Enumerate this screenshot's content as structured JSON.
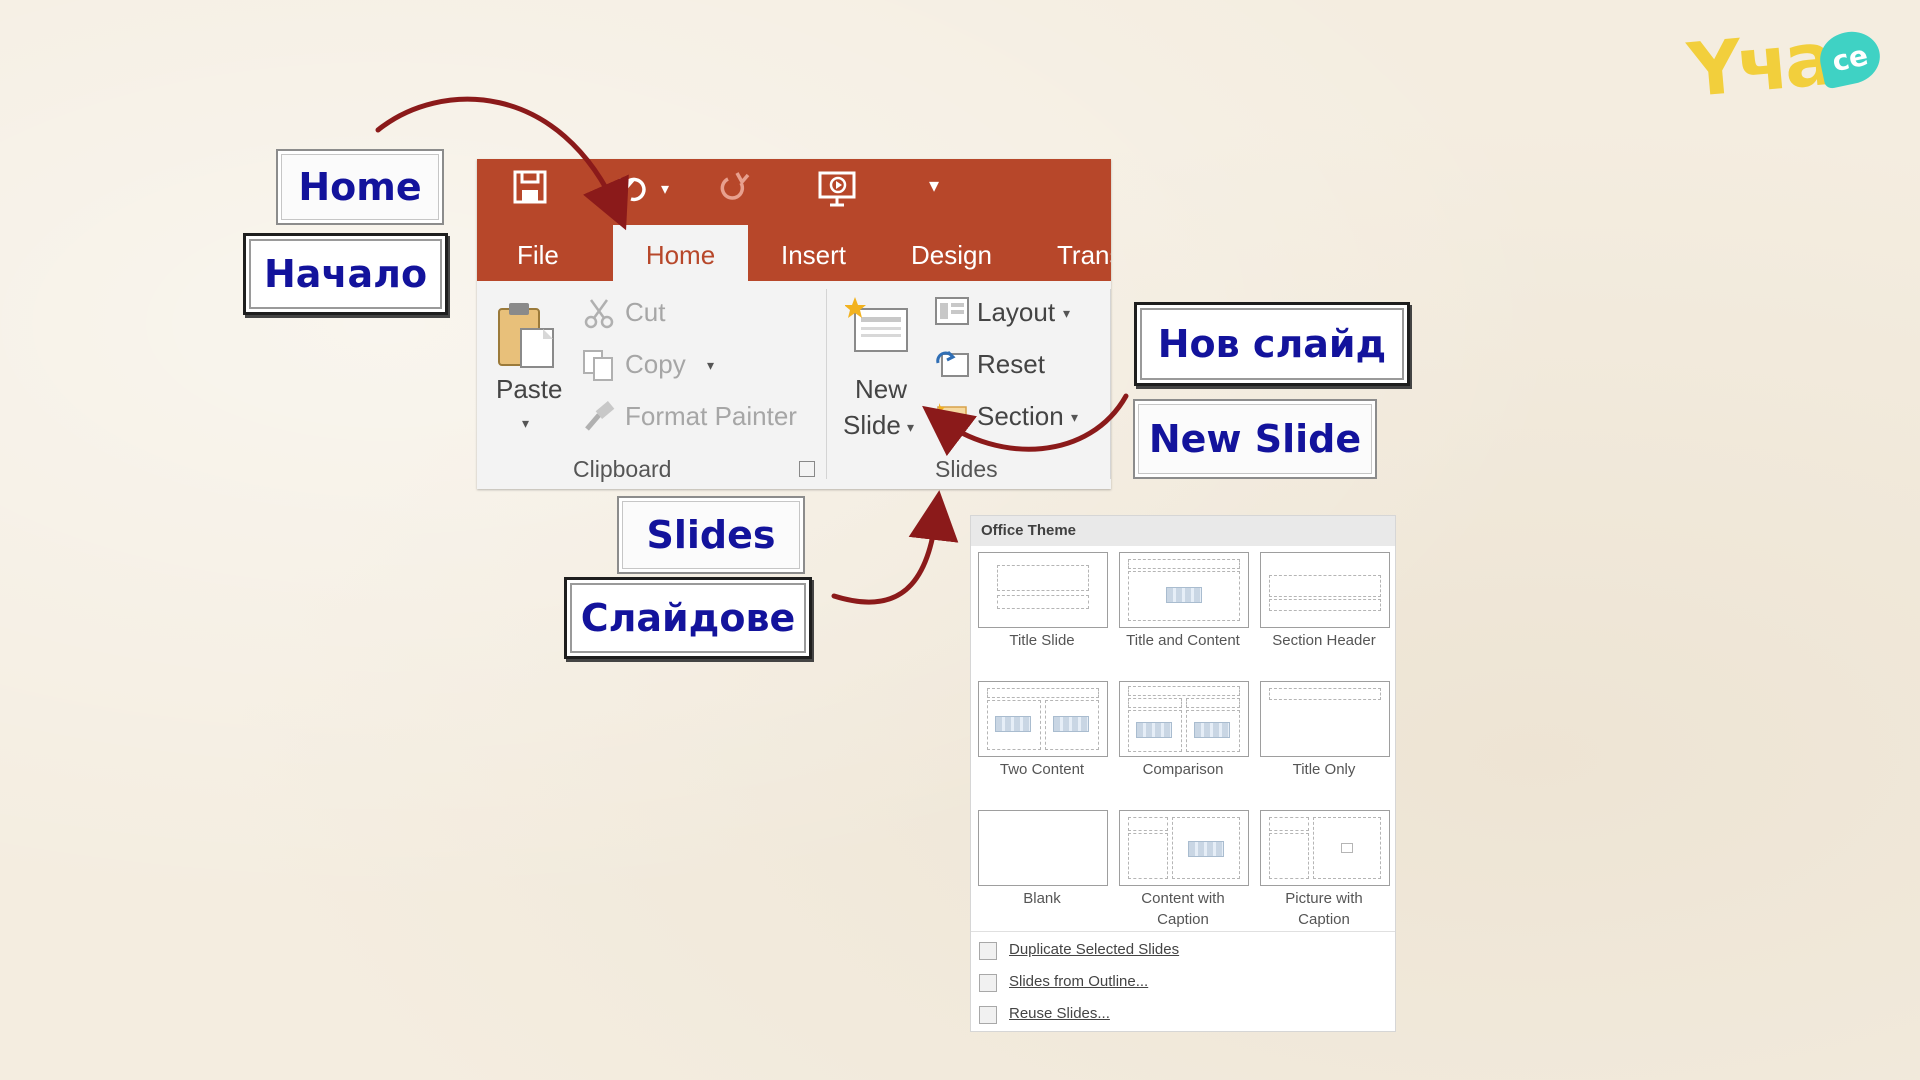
{
  "logo": {
    "word": "Yча",
    "badge": "ce"
  },
  "quick_access": {
    "save_icon": "save-icon",
    "undo_icon": "undo-icon",
    "redo_icon": "redo-icon",
    "presentation_icon": "start-presentation-icon",
    "customize_icon": "customize-toolbar-icon",
    "dropdown_glyph": "▾",
    "overflow_glyph": "▾"
  },
  "tabs": [
    {
      "label": "File"
    },
    {
      "label": "Home",
      "active": true
    },
    {
      "label": "Insert"
    },
    {
      "label": "Design"
    },
    {
      "label": "Trans"
    }
  ],
  "clipboard": {
    "paste_label": "Paste",
    "cut_label": "Cut",
    "copy_label": "Copy",
    "format_painter_label": "Format Painter",
    "group_label": "Clipboard"
  },
  "slides": {
    "new_label": "New",
    "slide_label": "Slide",
    "layout_label": "Layout",
    "reset_label": "Reset",
    "section_label": "Section",
    "group_label": "Slides"
  },
  "callouts": {
    "home_en": "Home",
    "home_bg": "Начало",
    "new_slide_bg": "Нов слайд",
    "new_slide_en": "New Slide",
    "slides_en": "Slides",
    "slides_bg": "Слайдове"
  },
  "dropdown": {
    "header": "Office Theme",
    "layouts": [
      {
        "name": "Title Slide"
      },
      {
        "name": "Title and Content"
      },
      {
        "name": "Section Header"
      },
      {
        "name": "Two Content"
      },
      {
        "name": "Comparison"
      },
      {
        "name": "Title Only"
      },
      {
        "name": "Blank"
      },
      {
        "name": "Content with Caption"
      },
      {
        "name": "Picture with Caption"
      }
    ],
    "menu": [
      {
        "label": "Duplicate Selected Slides"
      },
      {
        "label": "Slides from Outline..."
      },
      {
        "label": "Reuse Slides..."
      }
    ]
  },
  "colors": {
    "ribbon_accent": "#b7472a",
    "callout_text": "#13139c",
    "arrow": "#8b1a1a",
    "background": "#f4ede0"
  }
}
